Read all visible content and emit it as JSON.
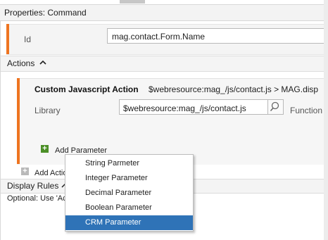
{
  "header": {
    "title": "Properties: Command"
  },
  "id_field": {
    "label": "Id",
    "value": "mag.contact.Form.Name"
  },
  "actions": {
    "label": "Actions",
    "card": {
      "title": "Custom Javascript Action",
      "subtitle": "$webresource:mag_/js/contact.js > MAG.disp",
      "library_label": "Library",
      "library_value": "$webresource:mag_/js/contact.js",
      "function_label": "Function N",
      "add_parameter": "Add Parameter"
    },
    "add_action": "Add Actio"
  },
  "display_rules": {
    "label": "Display Rules",
    "text": "Optional: Use 'Ac                                          me visibility dynamic."
  },
  "dropdown": {
    "items": [
      {
        "label": "String Parmeter"
      },
      {
        "label": "Integer Parameter"
      },
      {
        "label": "Decimal Parameter"
      },
      {
        "label": "Boolean Parameter"
      },
      {
        "label": "CRM Parameter"
      }
    ],
    "selected_index": 4
  },
  "colors": {
    "accent": "#ee7420",
    "selection": "#2f73b7",
    "add_icon": "#4b8f27"
  }
}
